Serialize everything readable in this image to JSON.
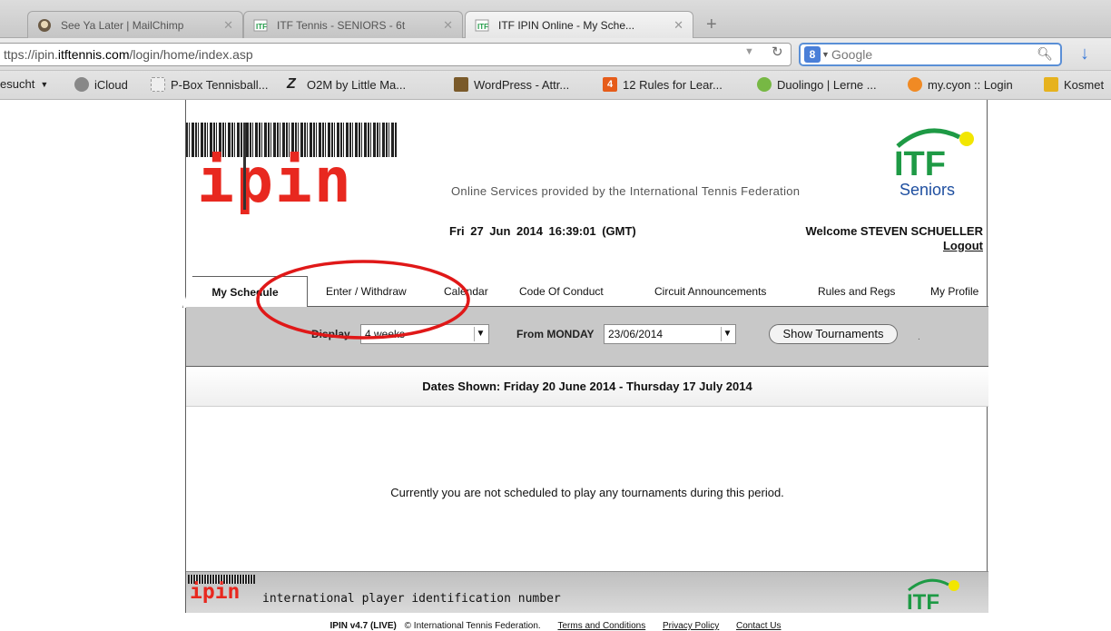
{
  "browser": {
    "tabs": [
      {
        "title": "See Ya Later | MailChimp"
      },
      {
        "title": "ITF Tennis - SENIORS - 6t"
      },
      {
        "title": "ITF IPIN Online - My Sche..."
      }
    ],
    "new_tab": "+",
    "url_host_prefix": "ttps://ipin.",
    "url_host_bold": "itftennis.com",
    "url_path": "/login/home/index.asp",
    "search_placeholder": "Google",
    "bookmarks": [
      {
        "label": "esucht",
        "color": "#b9b9b9"
      },
      {
        "label": "iCloud",
        "color": "#888888"
      },
      {
        "label": "P-Box Tennisball...",
        "color": "#dddddd"
      },
      {
        "label": "O2M by Little Ma...",
        "color": "#222222"
      },
      {
        "label": "WordPress - Attr...",
        "color": "#7a5a2a"
      },
      {
        "label": "12 Rules for Lear...",
        "color": "#e65c1a"
      },
      {
        "label": "Duolingo | Lerne ...",
        "color": "#77b844"
      },
      {
        "label": "my.cyon :: Login",
        "color": "#f08a24"
      },
      {
        "label": "Kosmet",
        "color": "#e6b21e"
      }
    ]
  },
  "header": {
    "logo_text": "ipin",
    "tagline": "Online Services provided by the International Tennis Federation",
    "datetime": "Fri 27 Jun 2014  16:39:01 (GMT)",
    "welcome": "Welcome STEVEN SCHUELLER",
    "logout": "Logout",
    "itf_text": "ITF",
    "itf_sub": "Seniors"
  },
  "tabs": [
    {
      "label": "My Schedule"
    },
    {
      "label": "Enter / Withdraw"
    },
    {
      "label": "Calendar"
    },
    {
      "label": "Code Of Conduct"
    },
    {
      "label": "Circuit Announcements"
    },
    {
      "label": "Rules and Regs"
    },
    {
      "label": "My Profile"
    }
  ],
  "options": {
    "display_label": "Display",
    "display_value": "4 weeks",
    "from_label": "From MONDAY",
    "from_value": "23/06/2014",
    "show_button": "Show Tournaments",
    "dot": "."
  },
  "content": {
    "dates_shown": "Dates Shown: Friday 20 June 2014 - Thursday 17 July 2014",
    "empty_message": "Currently you are not scheduled to play any tournaments during this period."
  },
  "footer": {
    "mini_logo": "ipin",
    "text": "international player identification number",
    "itf_text": "ITF",
    "version": "IPIN v4.7 (LIVE)",
    "copyright": "© International Tennis Federation.",
    "links": [
      "Terms and Conditions",
      "Privacy Policy",
      "Contact Us"
    ]
  },
  "colors": {
    "ipin_red": "#e8281f",
    "itf_green": "#1e9a45",
    "itf_yellow": "#f2e600",
    "seniors_blue": "#1f4fa0",
    "annotation_red": "#e01818"
  }
}
